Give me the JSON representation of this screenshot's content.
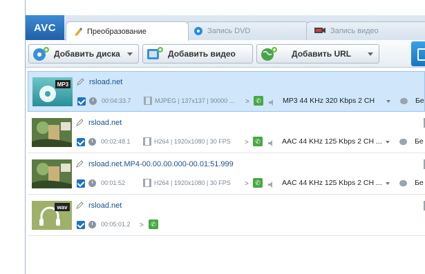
{
  "app": {
    "logo": "AVC",
    "tabs": [
      {
        "label": "Преобразование",
        "icon": "convert-icon",
        "active": true
      },
      {
        "label": "Запись DVD",
        "icon": "disc-icon",
        "active": false
      },
      {
        "label": "Запись видео",
        "icon": "record-icon",
        "active": false
      }
    ]
  },
  "toolbar": {
    "add_disc": "Добавить диска",
    "add_video": "Добавить видео",
    "add_url": "Добавить URL"
  },
  "files": [
    {
      "name": "rsload.net",
      "duration": "00:04:33.7",
      "video": "MJPEG | 137x137 | 90000 ...",
      "audio": "MP3 44 KHz 320 Kbps 2 CH",
      "sub": "Бе",
      "thumb": "mp3",
      "selected": true
    },
    {
      "name": "rsload.net",
      "duration": "00:02:48.1",
      "video": "H264 | 1920x1080 | 30 FPS",
      "audio": "AAC 44 KHz 125 Kbps 2 CH ...",
      "sub": "Бе",
      "thumb": "video",
      "selected": false
    },
    {
      "name": "rsload.net.MP4-00.00.00.000-00.01:51.999",
      "duration": "00:01:52",
      "video": "H264 | 1920x1080 | 30 FPS",
      "audio": "AAC 44 KHz 125 Kbps 2 CH ...",
      "sub": "Бе",
      "thumb": "video",
      "selected": false
    },
    {
      "name": "rsload.net",
      "duration": "00:05:01.2",
      "video": "",
      "audio": "",
      "sub": "",
      "thumb": "wav",
      "selected": false
    }
  ],
  "thumb_labels": {
    "mp3": "MP3",
    "wav": "wav"
  },
  "colors": {
    "accent": "#1f73c4",
    "selected_row": "#cfe6fb",
    "green": "#48a844"
  }
}
